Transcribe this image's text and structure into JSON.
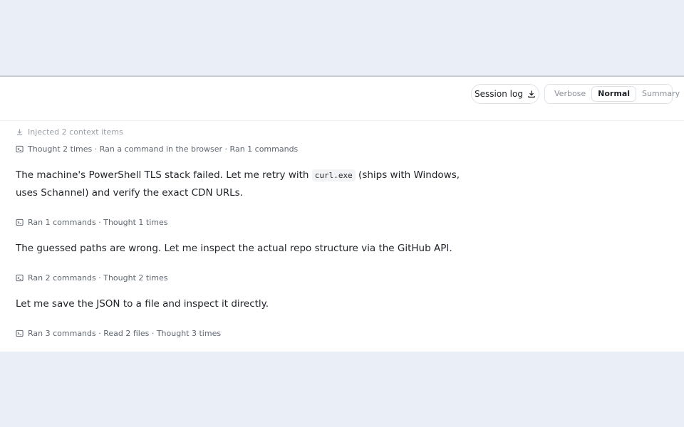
{
  "toolbar": {
    "session_log_label": "Session log",
    "view_modes": [
      "Verbose",
      "Normal",
      "Summary"
    ],
    "active_mode": "Normal"
  },
  "log": {
    "injected": "Injected 2 context items",
    "step1_meta": "Thought 2 times · Ran a command in the browser · Ran 1 commands",
    "msg1_before": "The machine's PowerShell TLS stack failed. Let me retry with ",
    "msg1_code": "curl.exe",
    "msg1_after": " (ships with Windows, uses Schannel) and verify the exact CDN URLs.",
    "step2_meta": "Ran 1 commands · Thought 1 times",
    "msg2": "The guessed paths are wrong. Let me inspect the actual repo structure via the GitHub API.",
    "step3_meta": "Ran 2 commands · Thought 2 times",
    "msg3": "Let me save the JSON to a file and inspect it directly.",
    "step4_meta": "Ran 3 commands · Read 2 files · Thought 3 times"
  }
}
